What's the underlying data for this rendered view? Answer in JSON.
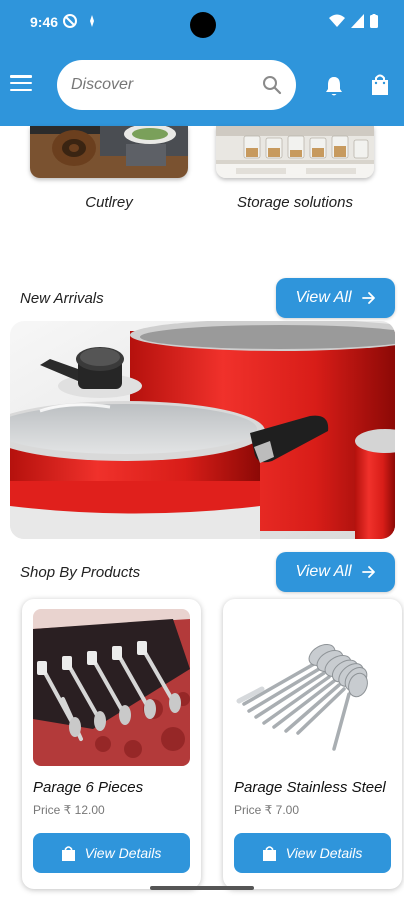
{
  "status": {
    "time": "9:46"
  },
  "search": {
    "placeholder": "Discover"
  },
  "categories": [
    {
      "label": "Cutlrey"
    },
    {
      "label": "Storage solutions"
    }
  ],
  "new_arrivals": {
    "title": "New Arrivals",
    "view_all": "View All"
  },
  "shop_by_products": {
    "title": "Shop By Products",
    "view_all": "View All"
  },
  "products": [
    {
      "name": "Parage 6 Pieces",
      "price": "Price ₹ 12.00",
      "button": "View Details"
    },
    {
      "name": "Parage Stainless Steel",
      "price": "Price ₹ 7.00",
      "button": "View Details"
    }
  ],
  "colors": {
    "primary": "#2f95db",
    "banner_red": "#e0201c"
  },
  "icons": [
    "menu-icon",
    "search-icon",
    "bell-icon",
    "shopping-bag-icon",
    "arrow-right-icon",
    "bag-icon"
  ]
}
